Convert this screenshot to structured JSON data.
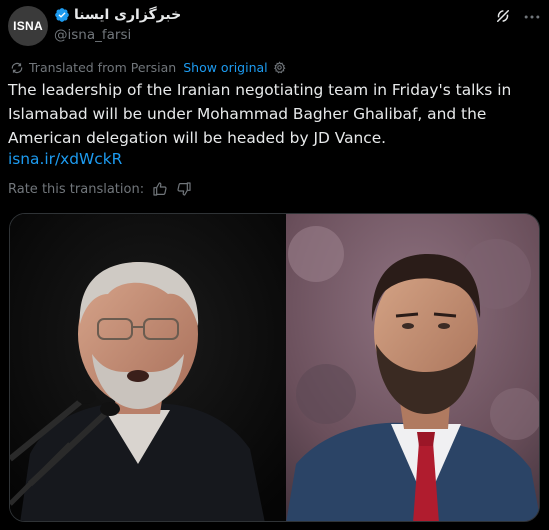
{
  "header": {
    "avatar_text": "ISNA",
    "display_name": "خبرگزاری ایسنا",
    "handle": "@isna_farsi",
    "verified_color": "#1d9bf0"
  },
  "translation": {
    "label": "Translated from Persian",
    "show_original": "Show original"
  },
  "tweet": {
    "text": "The leadership of the Iranian negotiating team in Friday's talks in Islamabad will be under Mohammad Bagher Ghalibaf, and the American delegation will be headed by JD Vance.",
    "link": "isna.ir/xdWckR"
  },
  "rating": {
    "label": "Rate this translation:"
  },
  "icons": [
    "translate-icon",
    "gear-icon",
    "thumbs-up-icon",
    "thumbs-down-icon",
    "grok-icon",
    "more-icon",
    "verified-badge-icon"
  ],
  "colors": {
    "background": "#000000",
    "text": "#e7e9ea",
    "secondary": "#71767b",
    "accent": "#1d9bf0"
  }
}
